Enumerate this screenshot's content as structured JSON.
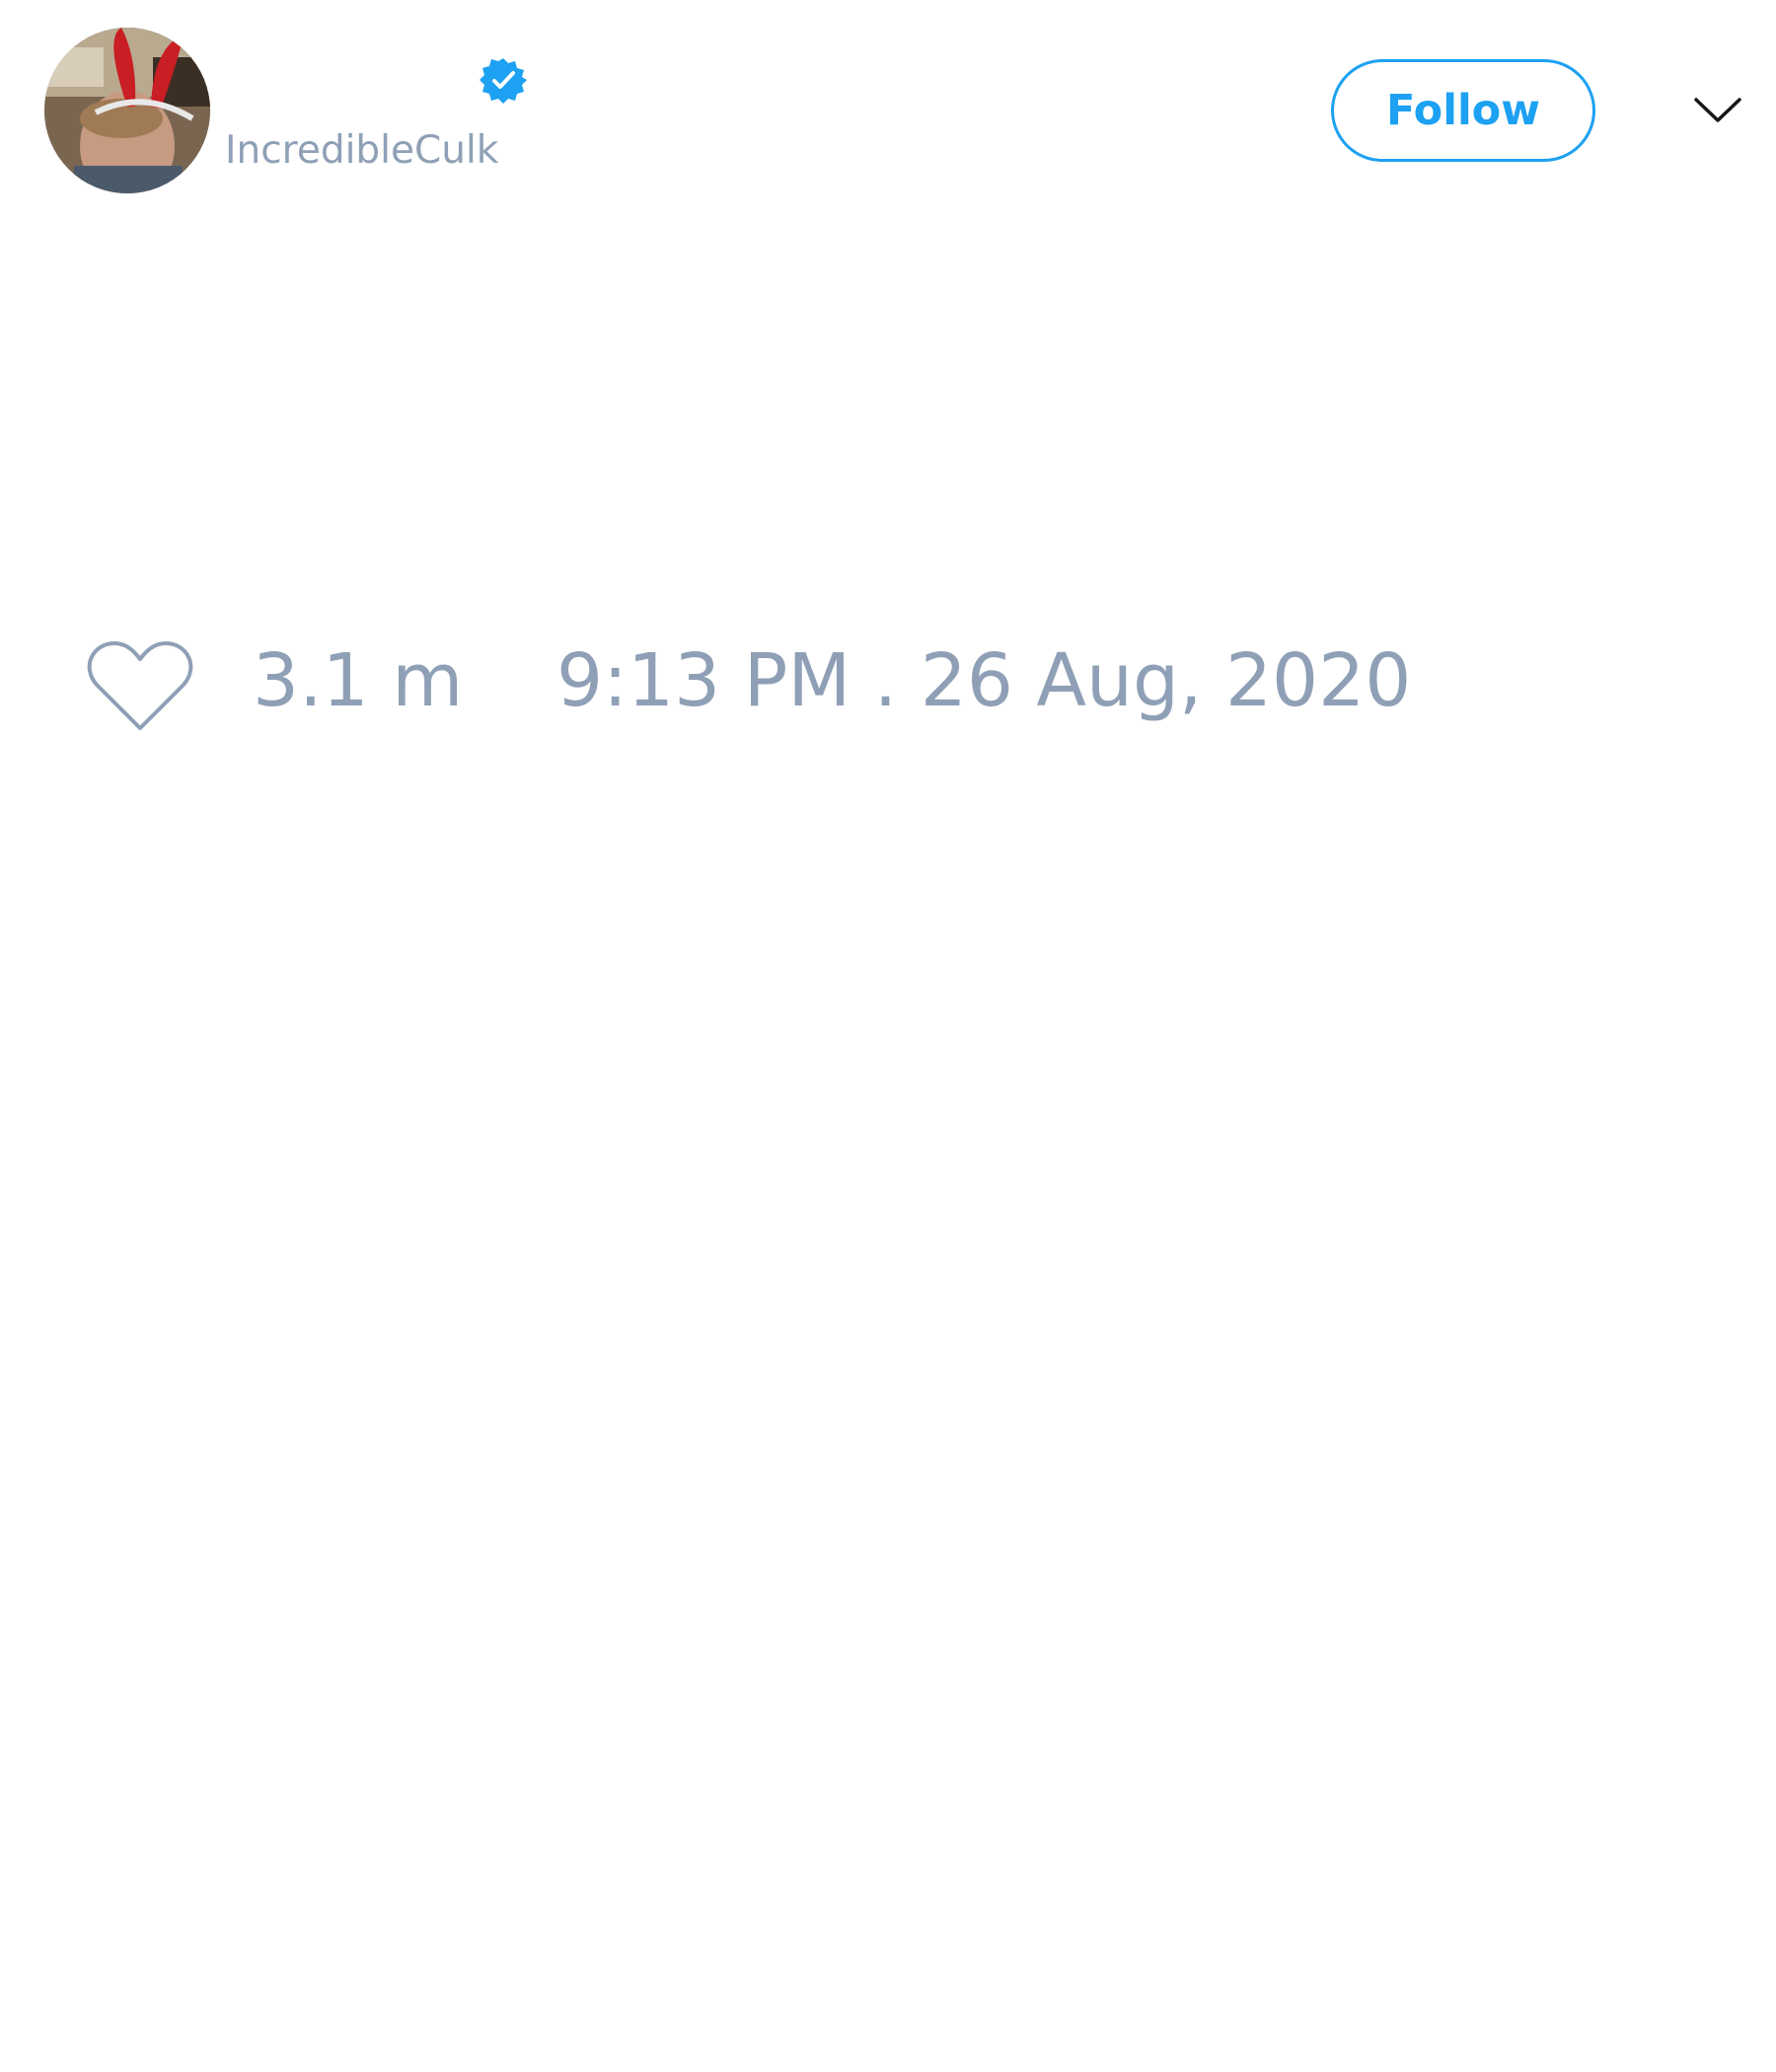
{
  "tweet": {
    "author": {
      "display_name": "",
      "handle": "IncredibleCulk",
      "verified": true,
      "avatar_icon": "profile-photo-bunny-ears"
    },
    "follow_label": "Follow",
    "menu_icon": "chevron-down-icon",
    "text": "",
    "like_icon": "heart-outline-icon",
    "like_count": "3.1 m",
    "timestamp": "9:13 PM . 26 Aug, 2020"
  },
  "colors": {
    "accent": "#1da1f2",
    "secondary_text": "#8fa0b6",
    "background": "#ffffff"
  }
}
